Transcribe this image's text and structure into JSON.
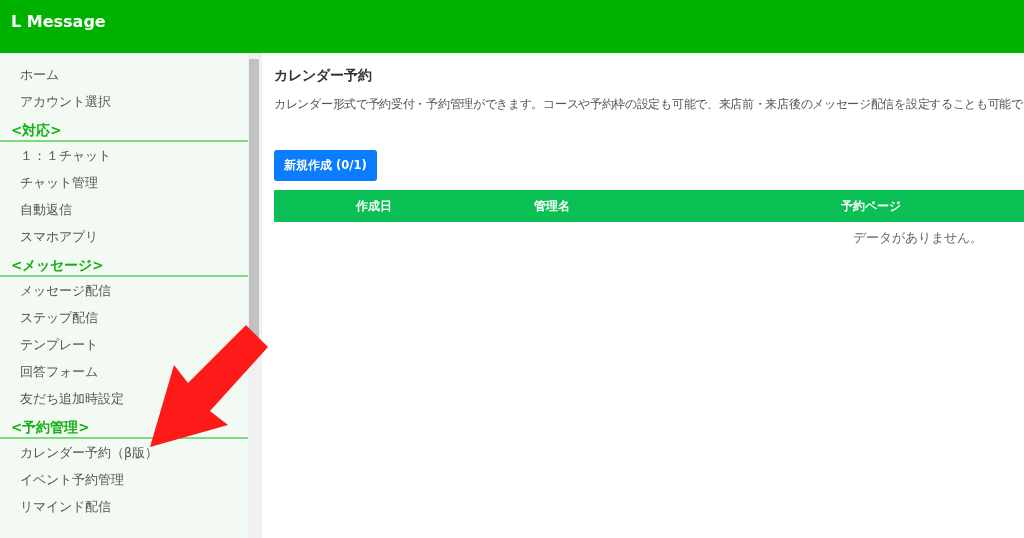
{
  "app": {
    "title": "L Message"
  },
  "sidebar": {
    "items": [
      {
        "kind": "link",
        "label": "ホーム"
      },
      {
        "kind": "link",
        "label": "アカウント選択"
      },
      {
        "kind": "section",
        "label": "<対応>"
      },
      {
        "kind": "link",
        "label": "１：１チャット"
      },
      {
        "kind": "link",
        "label": "チャット管理"
      },
      {
        "kind": "link",
        "label": "自動返信"
      },
      {
        "kind": "link",
        "label": "スマホアプリ"
      },
      {
        "kind": "section",
        "label": "<メッセージ>"
      },
      {
        "kind": "link",
        "label": "メッセージ配信"
      },
      {
        "kind": "link",
        "label": "ステップ配信"
      },
      {
        "kind": "link",
        "label": "テンプレート"
      },
      {
        "kind": "link",
        "label": "回答フォーム"
      },
      {
        "kind": "link",
        "label": "友だち追加時設定"
      },
      {
        "kind": "section",
        "label": "<予約管理>"
      },
      {
        "kind": "link",
        "label": "カレンダー予約（β版）"
      },
      {
        "kind": "link",
        "label": "イベント予約管理"
      },
      {
        "kind": "link",
        "label": "リマインド配信"
      }
    ]
  },
  "page": {
    "title": "カレンダー予約",
    "description": "カレンダー形式で予約受付・予約管理ができます。コースや予約枠の設定も可能で、来店前・来店後のメッセージ配信を設定することも可能で",
    "new_button": "新規作成 (0/1)"
  },
  "table": {
    "columns": [
      "作成日",
      "管理名",
      "予約ページ"
    ],
    "empty_message": "データがありません。"
  }
}
